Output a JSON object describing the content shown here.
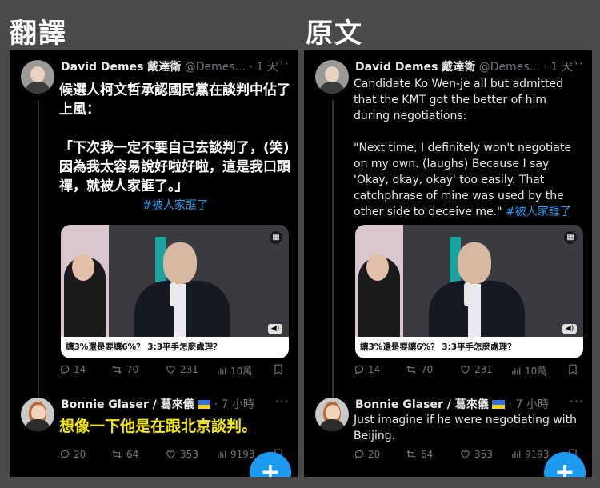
{
  "labels": {
    "translated": "翻譯",
    "original": "原文"
  },
  "left": {
    "tweet1": {
      "author": "David Demes 戴達衛",
      "handle_time": "@Demes... · 1 天",
      "text": "候選人柯文哲承認國民黨在談判中佔了上風：\n\n「下次我一定不要自己去談判了，(笑)因為我太容易說好啦好啦，這是我口頭禪，就被人家誆了。」",
      "hashtag": "#被人家誆了",
      "media_caption": "讓3%還是要讓6%？ 3:3平手怎麼處理？",
      "stats": {
        "replies": "14",
        "retweets": "70",
        "likes": "231",
        "views": "10萬"
      }
    },
    "tweet2": {
      "author": "Bonnie Glaser / 葛來儀",
      "handle_time": "· 7 小時",
      "text": "想像一下他是在跟北京談判。",
      "stats": {
        "replies": "20",
        "retweets": "64",
        "likes": "353",
        "views": "9193"
      }
    }
  },
  "right": {
    "tweet1": {
      "author": "David Demes 戴達衛",
      "handle_time": "@Demes... · 1 天",
      "text": "Candidate Ko Wen-je all but admitted that the KMT got the better of him during negotiations:\n\n\"Next time, I definitely won't negotiate on my own. (laughs) Because I say 'Okay, okay, okay' too easily. That catchphrase of mine was used by the other side to deceive me.\" ",
      "hashtag": "#被人家誆了",
      "media_caption": "讓3%還是要讓6%？ 3:3平手怎麼處理？",
      "stats": {
        "replies": "14",
        "retweets": "70",
        "likes": "231",
        "views": "10萬"
      }
    },
    "tweet2": {
      "author": "Bonnie Glaser / 葛來儀",
      "handle_time": "· 7 小時",
      "text": "Just imagine if he were negotiating with Beijing.",
      "stats": {
        "replies": "20",
        "retweets": "64",
        "likes": "353",
        "views": "9193"
      }
    }
  },
  "icons": {
    "reply": "reply-icon",
    "retweet": "retweet-icon",
    "like": "heart-icon",
    "views": "views-icon",
    "bookmark": "bookmark-icon",
    "compose": "plus-icon",
    "more": "more-icon",
    "flag": "ukraine-flag-icon"
  },
  "colors": {
    "accent": "#1d9bf0",
    "highlight": "#f5e800",
    "panel": "#000000"
  }
}
